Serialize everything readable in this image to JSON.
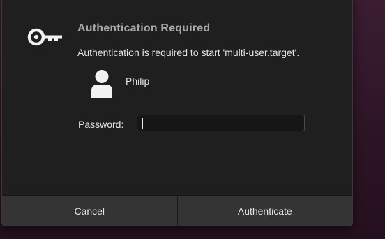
{
  "dialog": {
    "title": "Authentication Required",
    "message": "Authentication is required to start 'multi-user.target'.",
    "icon": "key-icon"
  },
  "user": {
    "name": "Philip",
    "avatar_icon": "user-avatar-icon"
  },
  "password": {
    "label": "Password:",
    "value": ""
  },
  "buttons": {
    "cancel": "Cancel",
    "authenticate": "Authenticate"
  },
  "colors": {
    "dialog_bg": "#1f1f1f",
    "button_bg": "#343434",
    "title_text": "#a7a7a7",
    "body_text": "#e4e4e4",
    "desktop_bg": "#2c1425"
  }
}
